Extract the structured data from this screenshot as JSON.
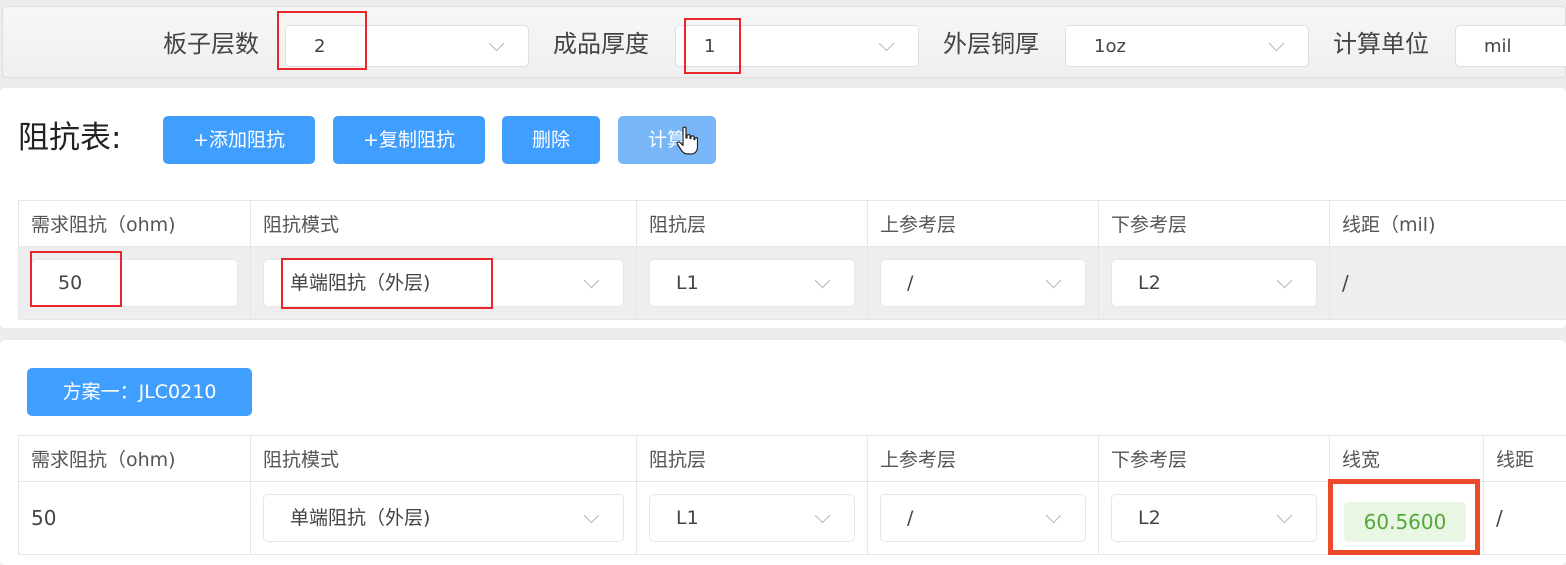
{
  "top_bar": {
    "board_layers": {
      "label": "板子层数",
      "value": "2"
    },
    "finished_thickness": {
      "label": "成品厚度",
      "value": "1"
    },
    "outer_copper": {
      "label": "外层铜厚",
      "value": "1oz"
    },
    "calc_unit": {
      "label": "计算单位",
      "value": "mil"
    }
  },
  "impedance_section": {
    "title": "阻抗表:",
    "buttons": {
      "add": "+添加阻抗",
      "copy": "+复制阻抗",
      "delete": "删除",
      "calculate": "计算"
    },
    "columns": [
      "需求阻抗（ohm)",
      "阻抗模式",
      "阻抗层",
      "上参考层",
      "下参考层",
      "线距（mil)"
    ],
    "row": {
      "impedance": "50",
      "mode": "单端阻抗（外层)",
      "layer": "L1",
      "upper_ref": "/",
      "lower_ref": "L2",
      "spacing": "/"
    }
  },
  "result_section": {
    "scheme_label": "方案一：JLC0210",
    "columns": [
      "需求阻抗（ohm)",
      "阻抗模式",
      "阻抗层",
      "上参考层",
      "下参考层",
      "线宽",
      "线距"
    ],
    "row": {
      "impedance": "50",
      "mode": "单端阻抗（外层)",
      "layer": "L1",
      "upper_ref": "/",
      "lower_ref": "L2",
      "line_width": "60.5600",
      "spacing": "/"
    }
  },
  "colors": {
    "primary": "#409eff",
    "primary_light": "#79b6f8",
    "highlight": "#e8262c",
    "result_text": "#55a83b",
    "result_bg": "#e9f6e3"
  },
  "icons": [
    "chevron-down-icon",
    "hand-pointer-cursor-icon"
  ]
}
